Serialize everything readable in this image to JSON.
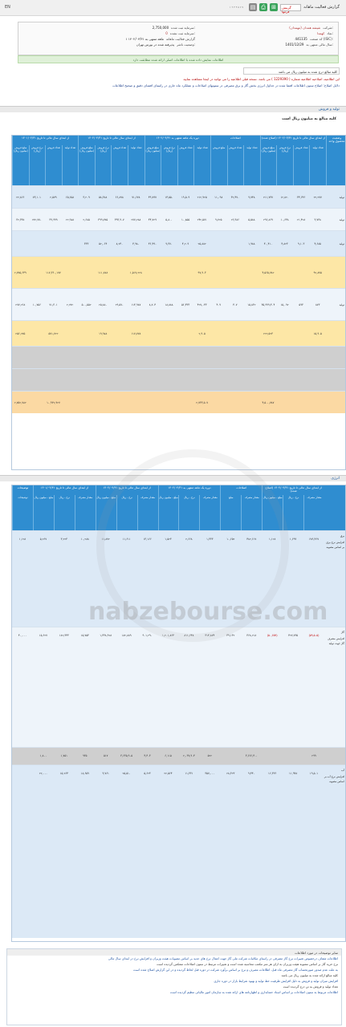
{
  "topbar": {
    "lang": "EN",
    "title": "گزارش فعالیت ماهانه",
    "dropdown": "گزینش فرمها",
    "digits": "۱ ۲ ۳ ۴ ۵ ۶ ۷"
  },
  "company": {
    "name_label": "شرکت:",
    "name_value": "شیشه همدان (مهمدان)",
    "symbol_label": "نماد:",
    "symbol_value": "کهمدا",
    "isic_label": "کد صنعت (ISIC):",
    "isic_value": "441135",
    "fiscal_label": "سال مالی منتهی به:",
    "fiscal_value": "1401/12/29",
    "capital_label": "سرمایه ثبت شده:",
    "capital_value": "2,750,000",
    "unregistered_label": "سرمایه ثبت نشده:",
    "unregistered_value": "0",
    "period_label": "گزارش فعالیت ماهانه",
    "period_value": "۱ ماهه منتهی به ۱۴۰۲/۰۴/۳۱",
    "status_label": "وضعیت ناشر:",
    "status_value": "پذیرفته شده در بورس تهران"
  },
  "banner": "اطلاعات نمایش داده شده با اطلاعات اصلی ارائه شده مطابقت دارد",
  "units_note": "کلیه مبالغ درج شده به میلیون ریال می باشد",
  "red_note": "این اطلاعیه، اصلاحیه اطلاعیه شماره ( 1229390 ) می باشد. نسخه قبلی اطلاعیه را می توانید در اینجا مشاهده نمایید",
  "blue_note": "دلایل اصلاح: اصلاح ستون اطلاعات افشا شده در جداول انرژی بخش گاز و برق مصرفی در ستونهای اصلاحات و عملکرد ماه جاری در راستای افشای دقیق و صحیح اطلاعات",
  "sales": {
    "section": "تولید و فروش",
    "subtitle": "کلیه مبالغ به میلیون ریال است",
    "groups": [
      "از ابتدای سال مالی تا تاریخ ۱۴۰۲/۰۳/۳۱ (اصلاح شده)",
      "اصلاحات",
      "دوره یک ماهه منتهی به ۱۴۰۲/۰۴/۳۱",
      "از ابتدای سال مالی تا تاریخ ۱۴۰۲/۰۴/۳۱",
      "از ابتدای سال مالی تا تاریخ ۱۴۰۱/۰۴/۳۱",
      "وضعیت محصول-واحد"
    ],
    "columns": [
      "تعداد تولید",
      "تعداد فروش",
      "نرخ فروش (ریال)",
      "مبلغ فروش (میلیون ریال)",
      "تعداد تولید",
      "تعداد فروش",
      "مبلغ فروش",
      "تعداد تولید",
      "تعداد فروش",
      "نرخ فروش (ریال)",
      "مبلغ فروش (میلیون ریال)",
      "تعداد تولید",
      "تعداد فروش",
      "نرخ فروش (ریال)",
      "مبلغ فروش (میلیون ریال)",
      "تعداد تولید",
      "تعداد فروش",
      "نرخ فروش (ریال)",
      "مبلغ فروش (میلیون ریال)"
    ],
    "rows": [
      {
        "label": "تولید",
        "vals": [
          "۲۲,۲۷۷",
          "۳۴,۶۴۶",
          "۱۲,۸۲۰",
          "۲۱۱,۷۳۷",
          "۹,۷۴۸",
          "۳۲,۴۷۰",
          "۱۱,۰۹۸",
          "۲۱۲,۹۲۵",
          "۱۹,۵۰۹",
          "۱۴,۵۵۰",
          "۴۹,۷۹۷",
          "۷۱,۶۷۸",
          "۶۶,۸۷۸",
          "۵۸,۳۸۸",
          "۳,۲۰۹",
          "۶۵,۶۵۸",
          "۲,۵۷۹",
          "۷۳,۱۰۱",
          "۲۲,۸۶۶"
        ]
      },
      {
        "label": "تولید",
        "vals": [
          "۳,۷۳۸",
          "۲۱,۴۲۸",
          "۱۰,۶۴۸",
          "۲۹۶,۸۶۹",
          "۵,۵۸۸",
          "۲۶,۳۸۶",
          "۹,۷۲۵",
          "۲۴۲,۵۷۱",
          "۱۰,۸۵۵",
          "۵,۸۰۰",
          "۴۴,۷۲۹",
          "۲۷۷,۲۸۸",
          "۳۹۳,۹۰۷",
          "۳۹۹,۷۷۵",
          "۲,۶۸۵",
          "۲۲,۹۸۸",
          "۳۹,۹۹۹",
          "۲۷۲,۷۷۰",
          "۳۲,۳۴۸"
        ]
      },
      {
        "label": "تولید",
        "vals": [
          "۴,۶۸۵",
          "۹,۱۰۳",
          "۴,۸۲۳",
          "۴۰,۴۱۰",
          "۱,۹۸۸",
          "",
          "",
          "۲۵,۸۸۲",
          "۴,۲۰۹",
          "۹,۳۷۰",
          "۴۶,۴۹۰",
          "۴,۹۸۰",
          "۸,۲۴۰",
          "۵۲,۰۶۴",
          "۳۳۳",
          "",
          "",
          "",
          ""
        ]
      },
      {
        "label": "",
        "vals": [
          "۹۲,۸۷۵",
          "",
          "",
          "۴,۵۶۵,۷۸۲",
          "",
          "",
          "",
          "۹۷,۹۰۳",
          "",
          "",
          "",
          "۱,۵۱۷,۲۲۸",
          "",
          "۱۱۱,۸۷۸",
          "",
          "",
          "۱۱۷,۳۶۰,۱۷۷",
          "",
          "۲,۷۷۵,۶۴۹"
        ]
      },
      {
        "label": "تولید",
        "vals": [
          "۸۷۳",
          "۵۹۳",
          "۱۵,۰۹۲",
          "۳۵,۹۹۹,۴۰۴",
          "۱۵,۸۳۲",
          "۴۰۷",
          "۴۰۹",
          "۴۲۷,۰۴۳",
          "۵۶,۴۳۳",
          "۱۸,۸۸۸",
          "۸,۷۰۴",
          "۱۱۴,۹۸۷",
          "۲۹,۵۷۰",
          "۲۵,۸۸۰",
          "۵۰۰,۵۵۲",
          "۲,۲۷۲",
          "۷۱,۳۰۱",
          "۱۰,۷۵۶",
          "۲۷۷,۲۶۸"
        ]
      },
      {
        "label": "",
        "vals": [
          "۱۵,۹۰۵",
          "",
          "",
          "۲۲۲,۵۲۳",
          "",
          "",
          "",
          "۲,۹۰۵",
          "",
          "",
          "",
          "۱۱۷,۷۷۸",
          "",
          "۱۹,۹۸۸",
          "",
          "",
          "۵۷۱,۷۲۲",
          "",
          "۲۵۶,۲۷۵"
        ]
      },
      {
        "label": "",
        "vals": [
          "",
          "",
          "",
          "",
          "",
          "",
          "",
          "",
          "",
          "",
          "",
          "",
          "",
          "",
          "",
          "",
          "",
          "",
          ""
        ]
      },
      {
        "label": "",
        "vals": [
          "",
          "",
          "",
          "",
          "",
          "",
          "",
          "",
          "",
          "",
          "",
          "",
          "",
          "",
          "",
          "",
          "",
          "",
          ""
        ]
      },
      {
        "label": "",
        "vals": [
          "",
          "",
          "",
          "۴,۵۰۰,۷۸۷",
          "",
          "",
          "",
          "۲,۷۳۳,۵۰۷",
          "",
          "",
          "",
          "",
          "",
          "",
          "",
          "",
          "۱۰,۹۳۲,۹۲۷",
          "",
          "۲,۷۵۲,۷۸۲"
        ]
      }
    ]
  },
  "energy": {
    "section": "انرژی",
    "groups": [
      "از ابتدای سال مالی تا تاریخ ۱۴۰۲/۰۳/۳۱ (اصلاح شده)",
      "اصلاحات",
      "دوره یک ماهه منتهی به ۱۴۰۲/۰۴/۳۱",
      "از ابتدای سال مالی تا تاریخ ۱۴۰۲/۰۴/۳۱",
      "از ابتدای سال مالی تا تاریخ ۱۴۰۱/۰۴/۳۱",
      "توضیحات"
    ],
    "columns": [
      "مقدار مصرف",
      "نرخ - ریال",
      "مبلغ - میلیون ریال",
      "مقدار مصرف",
      "مبلغ",
      "مقدار مصرف",
      "نرخ - ریال",
      "مبلغ - میلیون ریال",
      "مقدار مصرف",
      "نرخ - ریال",
      "مبلغ - میلیون ریال",
      "مقدار مصرف",
      "نرخ - ریال",
      "مبلغ - میلیون ریال",
      "توضیحات"
    ],
    "rows": [
      {
        "label": "برق",
        "vals": [
          "۶۸۹,۴۶۷",
          "۱,۶۹۹",
          "۱,۱۲۸",
          "۴۸۲,۶۱۷",
          "۱۰,۶۵۲",
          "۱,۳۳۳",
          "۲,۶۶۸",
          "۱,۵۲۳",
          "۱۳,۱۶۶",
          "۱۱,۶۱۱",
          "۱۱,۸۷۲",
          "۱۰,۲۸۸",
          "۳,۲۲۳",
          "۵,۲۶۷",
          "۱,۱۲۸"
        ]
      },
      {
        "label": "گاز",
        "vals": [
          "(۵۹,۵۰۵)",
          "۴۲۷,۷۳۵",
          "(۵۰,۶۵۹)",
          "۳۶۸,۲۱۸",
          "۳۹,۱۳۲",
          "۳۱۴,۸۷۴",
          "۸۱۱,۶۴۸",
          "۱,۲۰۱,۸۶۴",
          "۹۰۱,۲۹۰",
          "۱۸۲,۸۸۹",
          "۱,۳۳۸,۹۲۸",
          "۱۵,۷۵۳",
          "۱۸۲,۳۴۳",
          "۱۵,۶۲۷",
          "۴۰,۰۰۰"
        ]
      },
      {
        "label": "",
        "vals": [
          "۲۹۹",
          "",
          "",
          "۳,۶۶۶,۴۰۰",
          "",
          "۵۲۲",
          "۲,۰۳۷,۹۰۴",
          "۶,۱۱۵",
          "۴,۴۰۳",
          "۳,۶۳۵,۹۰۵",
          "۵۱۷",
          "۹۳۵",
          "۱,۷۵۱",
          "۱,۸۰۰",
          ""
        ]
      },
      {
        "label": "آب",
        "vals": [
          "۱۹,۵۰۱",
          "۱۱,۹۴۸",
          "۱۶,۳۳۶",
          "۹,۴۴۰",
          "۲۸,۳۲۳",
          "۳۵۷,۰۰۰",
          "۱۱,۳۳۱",
          "۲۲,۵۶۴",
          "۵,۶۲۳",
          "۲۵,۵۱۰",
          "۳,۷۶۱",
          "۱۸,۶۵۹",
          "۱۵,۲۶۴",
          "۲۲,۰۰۰",
          ""
        ]
      }
    ],
    "product_notes": [
      "افزایش نرخ برق بر اساس مصوبه",
      "افزایش مصرف گاز جهت تولید",
      "",
      "افزایش نرخ آب بر اساس مصوبه"
    ]
  },
  "notes": {
    "title": "سایر توضیحات در مورد اطلاعات",
    "lines": [
      "اطلاعات شفاف درخصوص تغییرات نرخ گاز مصرفی در راستای مکاتبات شرکت ملی گاز جهت اعمال نرخ های جدید بر اساس مصوبات هیئت وزیران و افزایش نرخ در ابتدای سال مالی",
      "نرخ خرید گاز بر اساس مصوبه هیئت وزیران به ازای هر متر مکعب محاسبه شده است و تغییرات مرتبط در ستون اصلاحات منعکس گردیده است",
      "به علت عدم صدور صورتحساب گاز مصرفی ماه قبل، اطلاعات مصرف و نرخ بر اساس برآورد شرکت در دوره قبل لحاظ گردیده و در این گزارش اصلاح شده است",
      "کلیه مبالغ ارائه شده به میلیون ریال می باشد",
      "افزایش میزان تولید و فروش به دلیل افزایش ظرفیت خط تولید و بهبود شرایط بازار در دوره جاری",
      "تعداد تولید و فروش به تن درج گردیده است",
      "اطلاعات مربوط به ستون اصلاحات بر اساس اسناد حسابداری و اظهارنامه های ارائه شده به سازمان امور مالیاتی تنظیم گردیده است"
    ]
  },
  "watermark": "nabzebourse.com"
}
